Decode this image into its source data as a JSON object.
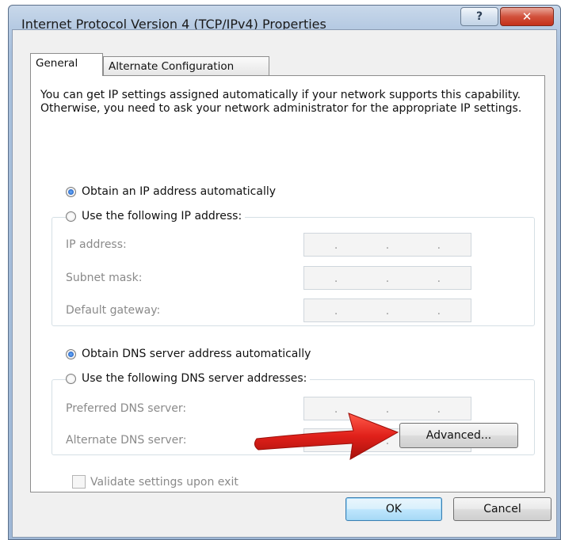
{
  "window": {
    "title": "Internet Protocol Version 4 (TCP/IPv4) Properties",
    "help_label": "?",
    "close_label": "✕"
  },
  "tabs": [
    {
      "label": "General",
      "selected": true
    },
    {
      "label": "Alternate Configuration",
      "selected": false
    }
  ],
  "intro_text": "You can get IP settings assigned automatically if your network supports this capability. Otherwise, you need to ask your network administrator for the appropriate IP settings.",
  "ip_section": {
    "auto_label": "Obtain an IP address automatically",
    "auto_checked": true,
    "manual_label": "Use the following IP address:",
    "manual_checked": false,
    "fields": [
      {
        "label": "IP address:",
        "value": ". . ."
      },
      {
        "label": "Subnet mask:",
        "value": ". . ."
      },
      {
        "label": "Default gateway:",
        "value": ". . ."
      }
    ]
  },
  "dns_section": {
    "auto_label": "Obtain DNS server address automatically",
    "auto_checked": true,
    "manual_label": "Use the following DNS server addresses:",
    "manual_checked": false,
    "fields": [
      {
        "label": "Preferred DNS server:",
        "value": ". . ."
      },
      {
        "label": "Alternate DNS server:",
        "value": ". . ."
      }
    ]
  },
  "validate": {
    "label": "Validate settings upon exit",
    "checked": false
  },
  "buttons": {
    "advanced": "Advanced...",
    "ok": "OK",
    "cancel": "Cancel"
  },
  "colors": {
    "annotation_arrow": "#e0201a",
    "selected_radio": "#1f5fc0"
  }
}
